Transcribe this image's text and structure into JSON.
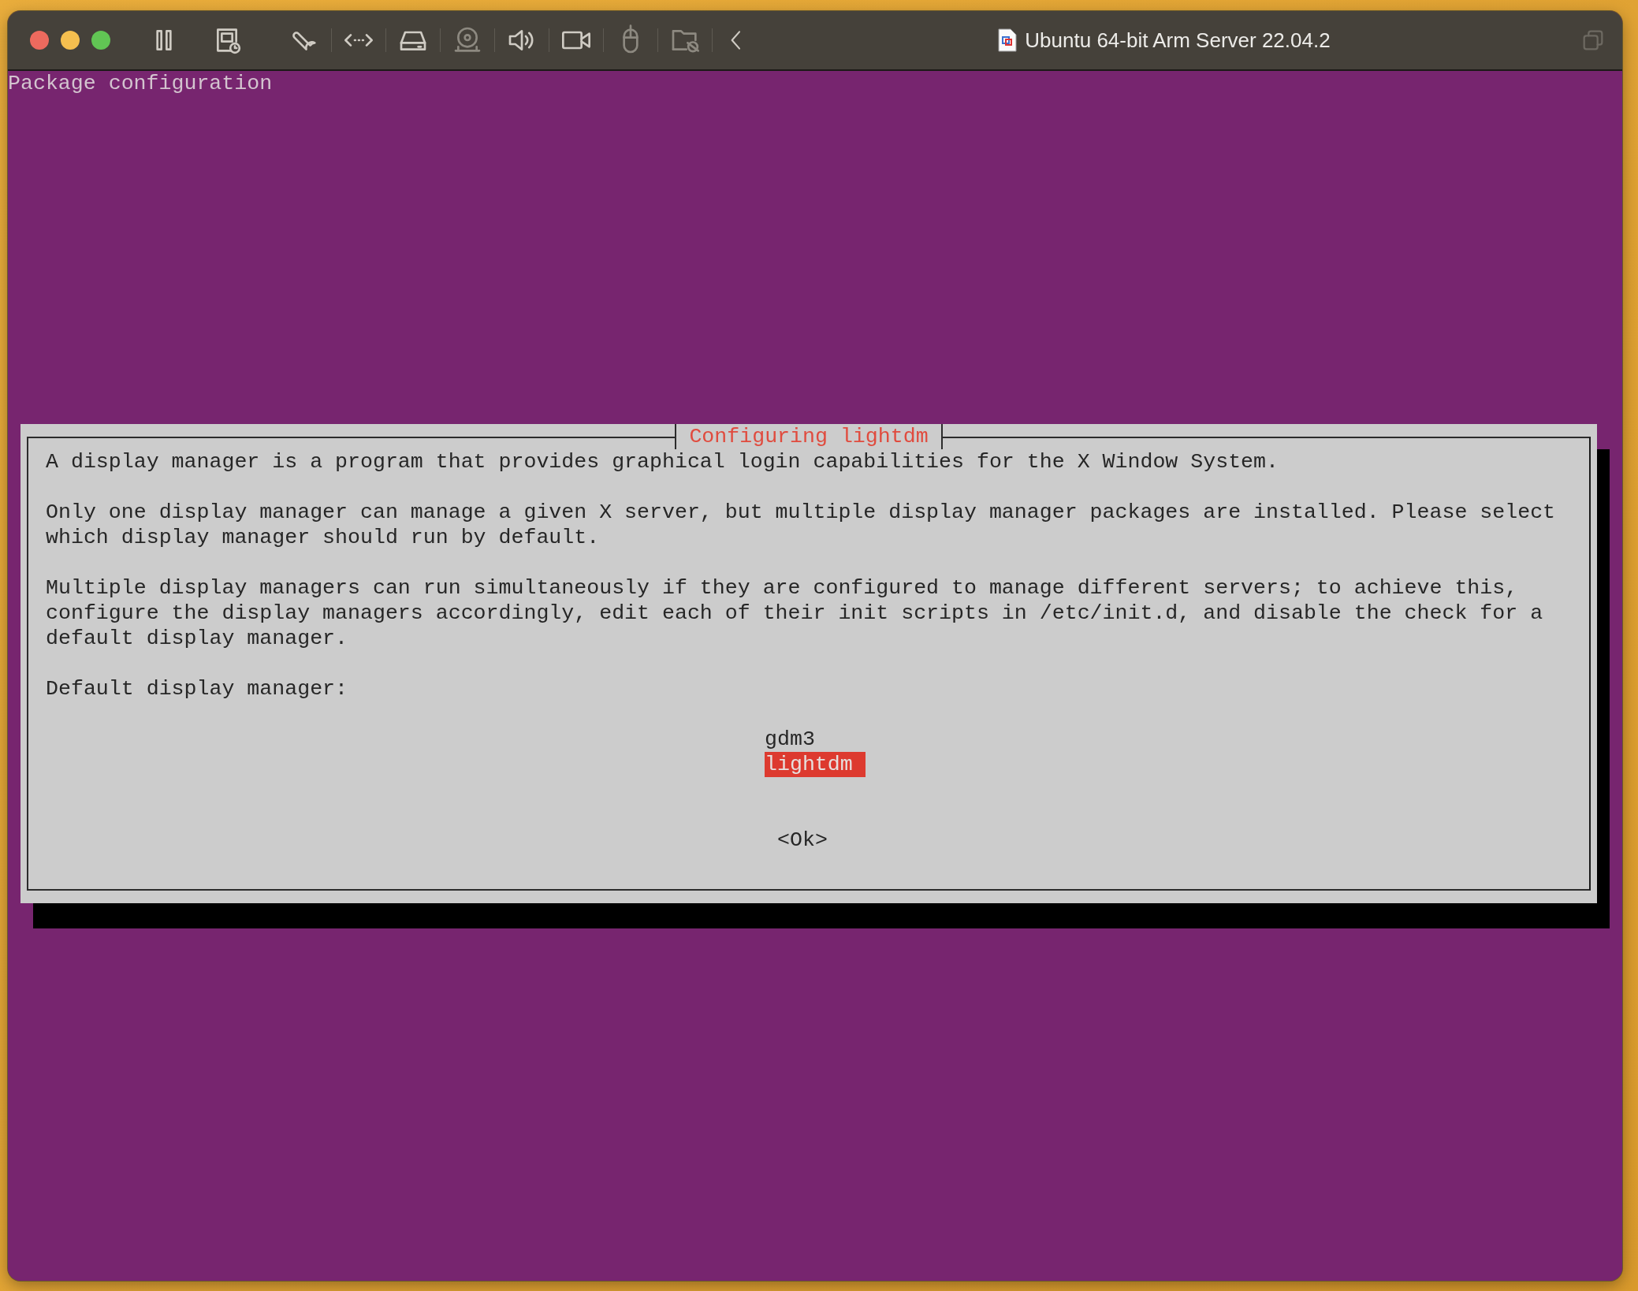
{
  "window": {
    "title": "Ubuntu 64-bit Arm Server 22.04.2"
  },
  "terminal": {
    "header": "Package configuration"
  },
  "dialog": {
    "title": "Configuring lightdm",
    "paragraphs": [
      [
        "A display manager is a program that provides graphical login capabilities for the X Window System."
      ],
      [
        "Only one display manager can manage a given X server, but multiple display manager packages are installed. Please select",
        "which display manager should run by default."
      ],
      [
        "Multiple display managers can run simultaneously if they are configured to manage different servers; to achieve this,",
        "configure the display managers accordingly, edit each of their init scripts in /etc/init.d, and disable the check for a",
        "default display manager."
      ]
    ],
    "prompt": "Default display manager:",
    "options": [
      {
        "label": "gdm3",
        "selected": false
      },
      {
        "label": "lightdm",
        "selected": true
      }
    ],
    "buttons": [
      "<Ok>"
    ]
  }
}
